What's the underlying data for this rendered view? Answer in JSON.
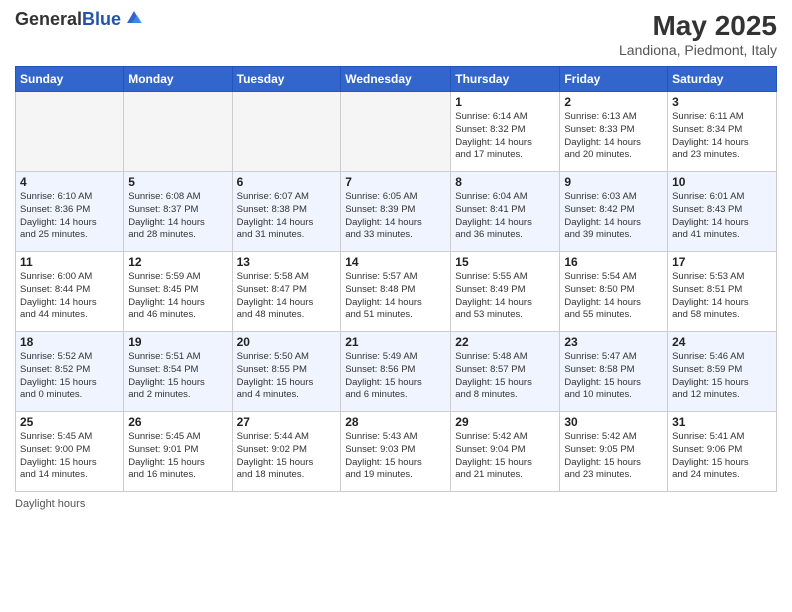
{
  "header": {
    "logo_general": "General",
    "logo_blue": "Blue",
    "month_year": "May 2025",
    "location": "Landiona, Piedmont, Italy"
  },
  "footer": {
    "daylight_label": "Daylight hours"
  },
  "weekdays": [
    "Sunday",
    "Monday",
    "Tuesday",
    "Wednesday",
    "Thursday",
    "Friday",
    "Saturday"
  ],
  "rows": [
    {
      "style": "normal",
      "cells": [
        {
          "day": "",
          "info": ""
        },
        {
          "day": "",
          "info": ""
        },
        {
          "day": "",
          "info": ""
        },
        {
          "day": "",
          "info": ""
        },
        {
          "day": "1",
          "info": "Sunrise: 6:14 AM\nSunset: 8:32 PM\nDaylight: 14 hours\nand 17 minutes."
        },
        {
          "day": "2",
          "info": "Sunrise: 6:13 AM\nSunset: 8:33 PM\nDaylight: 14 hours\nand 20 minutes."
        },
        {
          "day": "3",
          "info": "Sunrise: 6:11 AM\nSunset: 8:34 PM\nDaylight: 14 hours\nand 23 minutes."
        }
      ]
    },
    {
      "style": "alt",
      "cells": [
        {
          "day": "4",
          "info": "Sunrise: 6:10 AM\nSunset: 8:36 PM\nDaylight: 14 hours\nand 25 minutes."
        },
        {
          "day": "5",
          "info": "Sunrise: 6:08 AM\nSunset: 8:37 PM\nDaylight: 14 hours\nand 28 minutes."
        },
        {
          "day": "6",
          "info": "Sunrise: 6:07 AM\nSunset: 8:38 PM\nDaylight: 14 hours\nand 31 minutes."
        },
        {
          "day": "7",
          "info": "Sunrise: 6:05 AM\nSunset: 8:39 PM\nDaylight: 14 hours\nand 33 minutes."
        },
        {
          "day": "8",
          "info": "Sunrise: 6:04 AM\nSunset: 8:41 PM\nDaylight: 14 hours\nand 36 minutes."
        },
        {
          "day": "9",
          "info": "Sunrise: 6:03 AM\nSunset: 8:42 PM\nDaylight: 14 hours\nand 39 minutes."
        },
        {
          "day": "10",
          "info": "Sunrise: 6:01 AM\nSunset: 8:43 PM\nDaylight: 14 hours\nand 41 minutes."
        }
      ]
    },
    {
      "style": "normal",
      "cells": [
        {
          "day": "11",
          "info": "Sunrise: 6:00 AM\nSunset: 8:44 PM\nDaylight: 14 hours\nand 44 minutes."
        },
        {
          "day": "12",
          "info": "Sunrise: 5:59 AM\nSunset: 8:45 PM\nDaylight: 14 hours\nand 46 minutes."
        },
        {
          "day": "13",
          "info": "Sunrise: 5:58 AM\nSunset: 8:47 PM\nDaylight: 14 hours\nand 48 minutes."
        },
        {
          "day": "14",
          "info": "Sunrise: 5:57 AM\nSunset: 8:48 PM\nDaylight: 14 hours\nand 51 minutes."
        },
        {
          "day": "15",
          "info": "Sunrise: 5:55 AM\nSunset: 8:49 PM\nDaylight: 14 hours\nand 53 minutes."
        },
        {
          "day": "16",
          "info": "Sunrise: 5:54 AM\nSunset: 8:50 PM\nDaylight: 14 hours\nand 55 minutes."
        },
        {
          "day": "17",
          "info": "Sunrise: 5:53 AM\nSunset: 8:51 PM\nDaylight: 14 hours\nand 58 minutes."
        }
      ]
    },
    {
      "style": "alt",
      "cells": [
        {
          "day": "18",
          "info": "Sunrise: 5:52 AM\nSunset: 8:52 PM\nDaylight: 15 hours\nand 0 minutes."
        },
        {
          "day": "19",
          "info": "Sunrise: 5:51 AM\nSunset: 8:54 PM\nDaylight: 15 hours\nand 2 minutes."
        },
        {
          "day": "20",
          "info": "Sunrise: 5:50 AM\nSunset: 8:55 PM\nDaylight: 15 hours\nand 4 minutes."
        },
        {
          "day": "21",
          "info": "Sunrise: 5:49 AM\nSunset: 8:56 PM\nDaylight: 15 hours\nand 6 minutes."
        },
        {
          "day": "22",
          "info": "Sunrise: 5:48 AM\nSunset: 8:57 PM\nDaylight: 15 hours\nand 8 minutes."
        },
        {
          "day": "23",
          "info": "Sunrise: 5:47 AM\nSunset: 8:58 PM\nDaylight: 15 hours\nand 10 minutes."
        },
        {
          "day": "24",
          "info": "Sunrise: 5:46 AM\nSunset: 8:59 PM\nDaylight: 15 hours\nand 12 minutes."
        }
      ]
    },
    {
      "style": "normal",
      "cells": [
        {
          "day": "25",
          "info": "Sunrise: 5:45 AM\nSunset: 9:00 PM\nDaylight: 15 hours\nand 14 minutes."
        },
        {
          "day": "26",
          "info": "Sunrise: 5:45 AM\nSunset: 9:01 PM\nDaylight: 15 hours\nand 16 minutes."
        },
        {
          "day": "27",
          "info": "Sunrise: 5:44 AM\nSunset: 9:02 PM\nDaylight: 15 hours\nand 18 minutes."
        },
        {
          "day": "28",
          "info": "Sunrise: 5:43 AM\nSunset: 9:03 PM\nDaylight: 15 hours\nand 19 minutes."
        },
        {
          "day": "29",
          "info": "Sunrise: 5:42 AM\nSunset: 9:04 PM\nDaylight: 15 hours\nand 21 minutes."
        },
        {
          "day": "30",
          "info": "Sunrise: 5:42 AM\nSunset: 9:05 PM\nDaylight: 15 hours\nand 23 minutes."
        },
        {
          "day": "31",
          "info": "Sunrise: 5:41 AM\nSunset: 9:06 PM\nDaylight: 15 hours\nand 24 minutes."
        }
      ]
    }
  ]
}
